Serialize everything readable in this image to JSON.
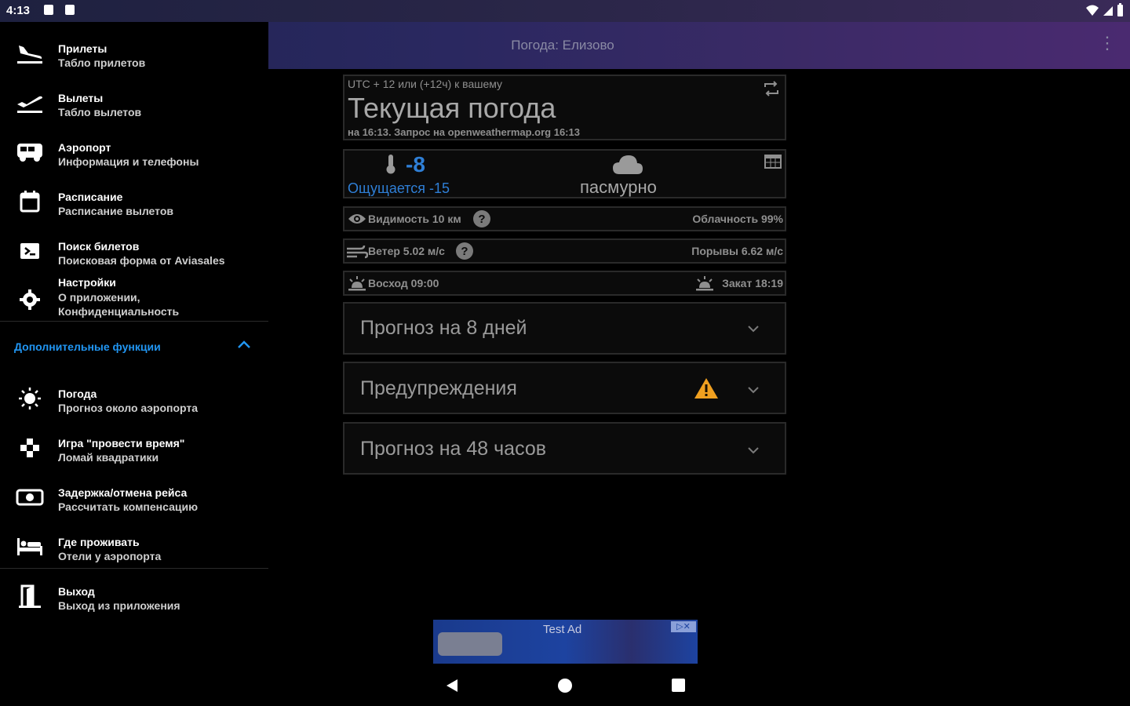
{
  "status": {
    "time": "4:13"
  },
  "appbar": {
    "title": "Погода: Елизово"
  },
  "drawer": {
    "items": [
      {
        "title": "Прилеты",
        "subtitle": "Табло прилетов",
        "icon": "flight-land-icon"
      },
      {
        "title": "Вылеты",
        "subtitle": "Табло вылетов",
        "icon": "flight-takeoff-icon"
      },
      {
        "title": "Аэропорт",
        "subtitle": "Информация и телефоны",
        "icon": "bus-icon"
      },
      {
        "title": "Расписание",
        "subtitle": "Расписание вылетов",
        "icon": "calendar-icon"
      },
      {
        "title": "Поиск билетов",
        "subtitle": "Поисковая форма от Aviasales",
        "icon": "ticket-search-icon"
      },
      {
        "title": "Настройки",
        "subtitle": "О приложении,",
        "subtitle2": "Конфиденциальность",
        "icon": "settings-icon"
      }
    ],
    "section_label": "Дополнительные функции",
    "extra_items": [
      {
        "title": "Погода",
        "subtitle": "Прогноз около аэропорта",
        "icon": "sun-icon"
      },
      {
        "title": "Игра \"провести время\"",
        "subtitle": "Ломай квадратики",
        "icon": "game-icon"
      },
      {
        "title": "Задержка/отмена рейса",
        "subtitle": "Рассчитать компенсацию",
        "icon": "money-icon"
      },
      {
        "title": "Где проживать",
        "subtitle": "Отели у аэропорта",
        "icon": "hotel-bed-icon"
      }
    ],
    "exit": {
      "title": "Выход",
      "subtitle": "Выход из приложения",
      "icon": "exit-door-icon"
    }
  },
  "weather": {
    "tz": "UTC + 12 или (+12ч) к вашему",
    "heading": "Текущая погода",
    "request_info": "на 16:13. Запрос на openweathermap.org 16:13",
    "temperature": "-8",
    "feels_like": "Ощущается -15",
    "condition": "пасмурно",
    "visibility": "Видимость 10 км",
    "cloudiness": "Облачность 99%",
    "wind": "Ветер 5.02 м/с",
    "gusts": "Порывы 6.62 м/с",
    "sunrise": "Восход 09:00",
    "sunset": "Закат 18:19"
  },
  "sections": [
    {
      "title": "Прогноз на 8 дней",
      "warning": false
    },
    {
      "title": "Предупреждения",
      "warning": true
    },
    {
      "title": "Прогноз на 48 часов",
      "warning": false
    }
  ],
  "ad": {
    "label": "Test Ad"
  },
  "colors": {
    "accent": "#2196f3",
    "warning": "#f0a020",
    "appbar_start": "#1f2452",
    "appbar_end": "#4a2a70"
  }
}
